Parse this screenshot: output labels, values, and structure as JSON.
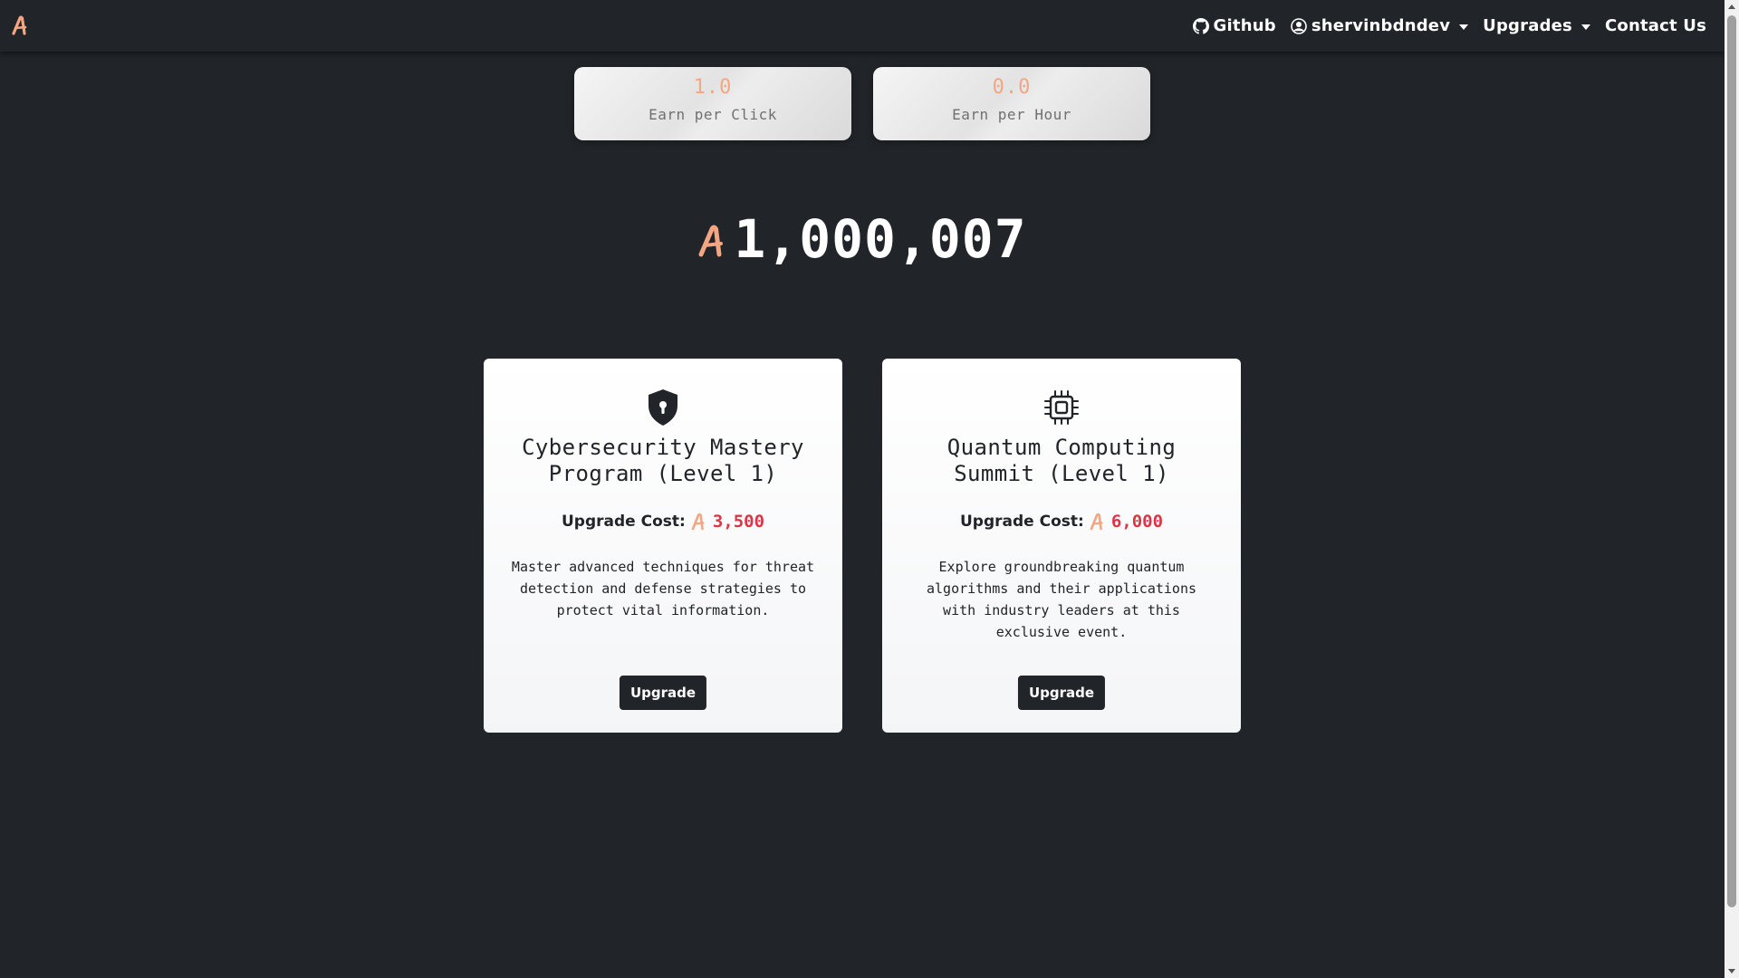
{
  "navbar": {
    "brand_icon": "a-coin-logo",
    "links": {
      "github": "Github",
      "user": "shervinbdndev",
      "upgrades": "Upgrades",
      "contact": "Contact Us"
    }
  },
  "stats": {
    "earn_per_click": {
      "value": "1.0",
      "label": "Earn per Click"
    },
    "earn_per_hour": {
      "value": "0.0",
      "label": "Earn per Hour"
    }
  },
  "balance": {
    "currency_icon": "a-coin-icon",
    "value": "1,000,007"
  },
  "cards": [
    {
      "icon": "shield-lock-icon",
      "title": "Cybersecurity Mastery Program (Level 1)",
      "cost_label": "Upgrade Cost:",
      "cost_value": "3,500",
      "description": "Master advanced techniques for threat detection and defense strategies to protect vital information.",
      "button": "Upgrade"
    },
    {
      "icon": "cpu-chip-icon",
      "title": "Quantum Computing Summit (Level 1)",
      "cost_label": "Upgrade Cost:",
      "cost_value": "6,000",
      "description": "Explore groundbreaking quantum algorithms and their applications with industry leaders at this exclusive event.",
      "button": "Upgrade"
    }
  ],
  "colors": {
    "background": "#212529",
    "accent": "#f4a582",
    "cost": "#dc3545",
    "card": "#ffffff"
  }
}
